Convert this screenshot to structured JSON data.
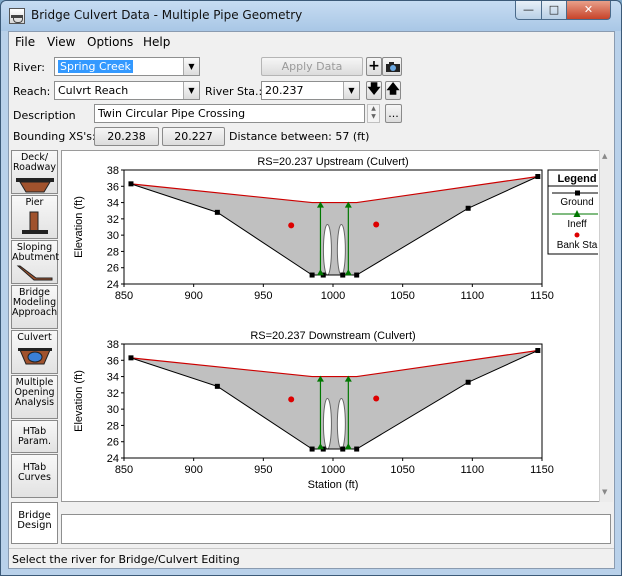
{
  "window": {
    "title": "Bridge Culvert Data - Multiple Pipe Geometry"
  },
  "menu": [
    "File",
    "View",
    "Options",
    "Help"
  ],
  "form": {
    "river_label": "River:",
    "river_value": "Spring Creek",
    "apply_label": "Apply Data",
    "reach_label": "Reach:",
    "reach_value": "Culvrt Reach",
    "river_sta_label": "River Sta.:",
    "river_sta_value": "20.237",
    "description_label": "Description",
    "description_value": "Twin Circular Pipe Crossing",
    "bounding_label": "Bounding XS's:",
    "bounding_up": "20.238",
    "bounding_down": "20.227",
    "distance_text": "Distance between: 57 (ft)",
    "browse_label": "..."
  },
  "sidebar": [
    {
      "label": "Deck/ Roadway",
      "icon": "deck-roadway-icon"
    },
    {
      "label": "Pier",
      "icon": "pier-icon"
    },
    {
      "label": "Sloping Abutment",
      "icon": "sloping-abutment-icon"
    },
    {
      "label": "Bridge Modeling Approach",
      "icon": ""
    },
    {
      "label": "Culvert",
      "icon": "culvert-icon"
    },
    {
      "label": "Multiple Opening Analysis",
      "icon": ""
    },
    {
      "label": "HTab Param.",
      "icon": ""
    },
    {
      "label": "HTab Curves",
      "icon": ""
    },
    {
      "label": "Bridge Design",
      "icon": ""
    }
  ],
  "status": "Select the river for Bridge/Culvert Editing",
  "colors": {
    "ground": "#000000",
    "bank_line": "#cc0000",
    "ineff": "#007700",
    "fill": "#c0c0c0",
    "bank_sta": "#dd0000"
  },
  "chart_data": [
    {
      "type": "line",
      "title": "RS=20.237  Upstream  (Culvert)",
      "ylabel": "Elevation (ft)",
      "xlabel": "",
      "xlim": [
        850,
        1150
      ],
      "ylim": [
        24,
        38
      ],
      "xticks": [
        850,
        900,
        950,
        1000,
        1050,
        1100,
        1150
      ],
      "yticks": [
        24,
        26,
        28,
        30,
        32,
        34,
        36,
        38
      ],
      "ground": [
        [
          855,
          36.3
        ],
        [
          917,
          32.8
        ],
        [
          985,
          25.1
        ],
        [
          1017,
          25.1
        ],
        [
          1097,
          33.3
        ],
        [
          1147,
          37.2
        ]
      ],
      "ground_marks": [
        [
          855,
          36.3
        ],
        [
          917,
          32.8
        ],
        [
          985,
          25.1
        ],
        [
          993,
          25.1
        ],
        [
          1007,
          25.1
        ],
        [
          1017,
          25.1
        ],
        [
          1097,
          33.3
        ],
        [
          1147,
          37.2
        ]
      ],
      "roadway": [
        [
          855,
          36.3
        ],
        [
          985,
          34.0
        ],
        [
          1017,
          34.0
        ],
        [
          1147,
          37.2
        ]
      ],
      "bank_sta": [
        [
          970,
          31.2
        ],
        [
          1031,
          31.3
        ]
      ],
      "ineff": [
        {
          "x": 991,
          "bottom": 25.2,
          "top": 34.0
        },
        {
          "x": 1011,
          "bottom": 25.2,
          "top": 34.0
        }
      ],
      "culverts": [
        {
          "center": 996,
          "bottom": 25.1,
          "top": 31.3
        },
        {
          "center": 1006,
          "bottom": 25.1,
          "top": 31.3
        }
      ],
      "legend": {
        "title": "Legend",
        "items": [
          "Ground",
          "Ineff",
          "Bank Sta"
        ]
      }
    },
    {
      "type": "line",
      "title": "RS=20.237  Downstream  (Culvert)",
      "ylabel": "Elevation (ft)",
      "xlabel": "Station (ft)",
      "xlim": [
        850,
        1150
      ],
      "ylim": [
        24,
        38
      ],
      "xticks": [
        850,
        900,
        950,
        1000,
        1050,
        1100,
        1150
      ],
      "yticks": [
        24,
        26,
        28,
        30,
        32,
        34,
        36,
        38
      ],
      "ground": [
        [
          855,
          36.3
        ],
        [
          917,
          32.8
        ],
        [
          985,
          25.1
        ],
        [
          1017,
          25.1
        ],
        [
          1097,
          33.3
        ],
        [
          1147,
          37.2
        ]
      ],
      "ground_marks": [
        [
          855,
          36.3
        ],
        [
          917,
          32.8
        ],
        [
          985,
          25.1
        ],
        [
          993,
          25.1
        ],
        [
          1007,
          25.1
        ],
        [
          1017,
          25.1
        ],
        [
          1097,
          33.3
        ],
        [
          1147,
          37.2
        ]
      ],
      "roadway": [
        [
          855,
          36.3
        ],
        [
          985,
          34.0
        ],
        [
          1017,
          34.0
        ],
        [
          1147,
          37.2
        ]
      ],
      "bank_sta": [
        [
          970,
          31.2
        ],
        [
          1031,
          31.3
        ]
      ],
      "ineff": [
        {
          "x": 991,
          "bottom": 25.2,
          "top": 34.0
        },
        {
          "x": 1011,
          "bottom": 25.2,
          "top": 34.0
        }
      ],
      "culverts": [
        {
          "center": 996,
          "bottom": 25.1,
          "top": 31.3
        },
        {
          "center": 1006,
          "bottom": 25.1,
          "top": 31.3
        }
      ]
    }
  ]
}
